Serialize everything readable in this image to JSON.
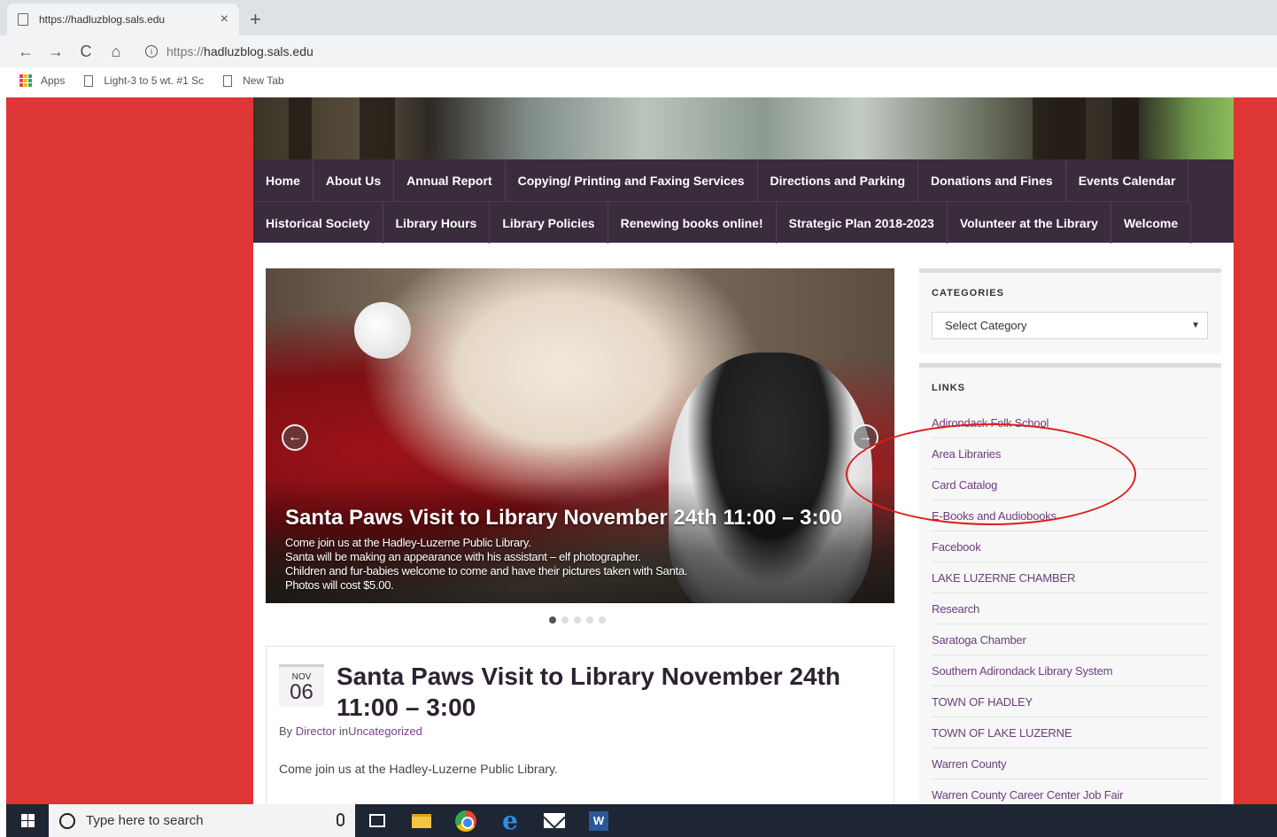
{
  "browser": {
    "tab_title": "https://hadluzblog.sals.edu",
    "tab_close": "×",
    "new_tab": "+",
    "address_scheme": "https://",
    "address_host": "hadluzblog.sals.edu",
    "nav": {
      "back": "←",
      "forward": "→",
      "reload": "C",
      "home": "⌂",
      "info": "i"
    },
    "bookmarks": [
      {
        "label": "Apps"
      },
      {
        "label": "Light-3 to 5 wt. #1 Sc"
      },
      {
        "label": "New Tab"
      }
    ]
  },
  "site": {
    "nav_row1": [
      "Home",
      "About Us",
      "Annual Report",
      "Copying/ Printing and Faxing Services",
      "Directions and Parking",
      "Donations and Fines",
      "Events Calendar"
    ],
    "nav_row2": [
      "Historical Society",
      "Library Hours",
      "Library Policies",
      "Renewing books online!",
      "Strategic Plan 2018-2023",
      "Volunteer at the Library",
      "Welcome"
    ],
    "slider": {
      "title": "Santa Paws Visit to Library November 24th 11:00 – 3:00",
      "lines": [
        "Come join us at the Hadley-Luzerne Public Library.",
        "Santa will be making an appearance with his assistant – elf photographer.",
        "Children and fur-babies welcome to come and have their pictures taken with Santa.",
        "Photos will cost $5.00."
      ],
      "slide_count": 5,
      "active_slide": 1
    },
    "post": {
      "month": "NOV",
      "day": "06",
      "title": "Santa Paws Visit to Library November 24th 11:00 – 3:00",
      "by_prefix": "By",
      "author": "Director",
      "in_prefix": "in",
      "category": "Uncategorized",
      "excerpt": "Come join us at the Hadley-Luzerne Public Library."
    },
    "sidebar": {
      "categories_title": "CATEGORIES",
      "select_value": "Select Category",
      "links_title": "LINKS",
      "links": [
        "Adirondack Folk School",
        "Area Libraries",
        "Card Catalog",
        "E-Books and Audiobooks",
        "Facebook",
        "LAKE LUZERNE CHAMBER",
        "Research",
        "Saratoga Chamber",
        "Southern Adirondack Library System",
        "TOWN OF HADLEY",
        "TOWN OF LAKE LUZERNE",
        "Warren County",
        "Warren County Career Center Job Fair"
      ]
    }
  },
  "taskbar": {
    "search_placeholder": "Type here to search",
    "word_letter": "W",
    "edge_letter": "e"
  },
  "colors": {
    "page_background": "#de3535",
    "nav_background": "#3a2b3d",
    "link": "#6c3e7d",
    "annotation": "#e01b1b"
  }
}
